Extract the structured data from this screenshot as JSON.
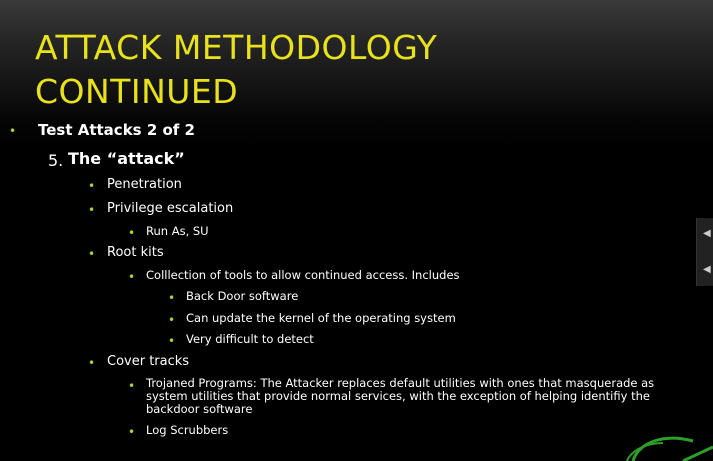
{
  "slide": {
    "title_line1": "ATTACK METHODOLOGY",
    "title_line2": "CONTINUED",
    "bullet_color": "#a9d62c",
    "title_color": "#e8e21c",
    "items": [
      {
        "text": "Test Attacks 2 of 2"
      },
      {
        "number": "5.",
        "text": "The “attack”"
      },
      {
        "text": "Penetration"
      },
      {
        "text": "Privilege escalation"
      },
      {
        "text": "Run As, SU"
      },
      {
        "text": "Root kits"
      },
      {
        "text": "Colllection of tools  to allow continued access.  Includes"
      },
      {
        "text": "Back Door software"
      },
      {
        "text": "Can update the kernel of the operating system"
      },
      {
        "text": "Very difficult to detect"
      },
      {
        "text": "Cover tracks"
      },
      {
        "text": "Trojaned Programs:  The Attacker replaces default utilities with ones that masquerade as system utilities that provide normal services, with the exception of helping identifiy the backdoor software"
      },
      {
        "text": "Log Scrubbers"
      }
    ]
  },
  "icons": {
    "bullet": "bullet-dot-icon",
    "nav_prev": "chevron-left-icon",
    "nav_next": "chevron-left-icon",
    "logo": "green-swoosh-logo"
  }
}
